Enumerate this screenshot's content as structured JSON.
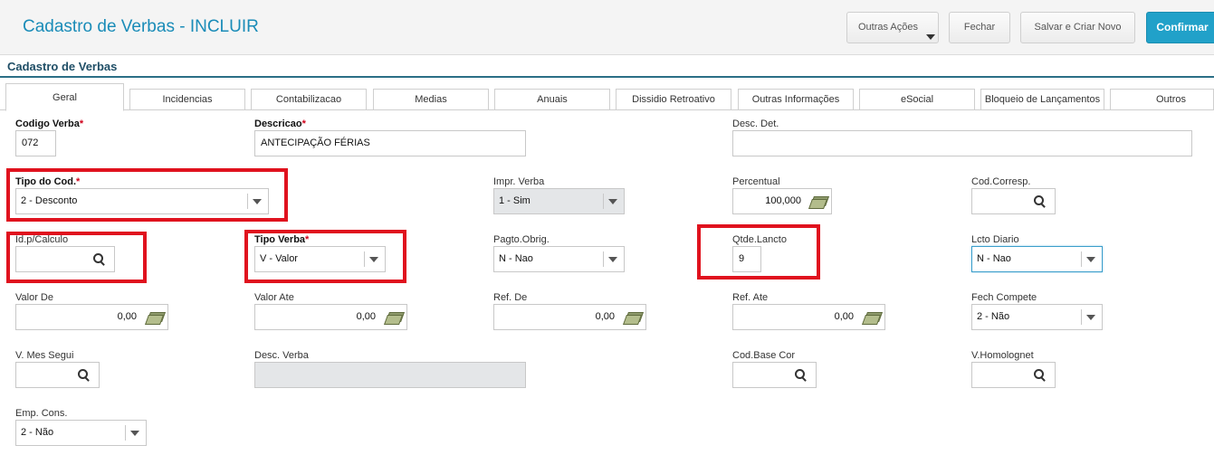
{
  "header": {
    "title": "Cadastro de Verbas - INCLUIR",
    "buttons": {
      "outras_acoes": "Outras Ações",
      "fechar": "Fechar",
      "salvar_criar": "Salvar e Criar Novo",
      "confirmar": "Confirmar"
    }
  },
  "section_title": "Cadastro de Verbas",
  "tabs": [
    "Geral",
    "Incidencias",
    "Contabilizacao",
    "Medias",
    "Anuais",
    "Dissidio Retroativo",
    "Outras Informações",
    "eSocial",
    "Bloqueio de Lançamentos",
    "Outros"
  ],
  "required_mark": "*",
  "fields": {
    "codigo_verba": {
      "label": "Codigo Verba",
      "value": "072"
    },
    "descricao": {
      "label": "Descricao",
      "value": "ANTECIPAÇÃO FÉRIAS"
    },
    "desc_det": {
      "label": "Desc. Det.",
      "value": ""
    },
    "tipo_cod": {
      "label": "Tipo do Cod.",
      "value": "2 - Desconto"
    },
    "impr_verba": {
      "label": "Impr. Verba",
      "value": "1 - Sim"
    },
    "percentual": {
      "label": "Percentual",
      "value": "100,000"
    },
    "cod_corresp": {
      "label": "Cod.Corresp.",
      "value": ""
    },
    "id_calculo": {
      "label": "Id.p/Calculo",
      "value": ""
    },
    "tipo_verba": {
      "label": "Tipo Verba",
      "value": "V - Valor"
    },
    "pagto_obrig": {
      "label": "Pagto.Obrig.",
      "value": "N - Nao"
    },
    "qtde_lancto": {
      "label": "Qtde.Lancto",
      "value": "9"
    },
    "lcto_diario": {
      "label": "Lcto Diario",
      "value": "N - Nao"
    },
    "valor_de": {
      "label": "Valor De",
      "value": "0,00"
    },
    "valor_ate": {
      "label": "Valor Ate",
      "value": "0,00"
    },
    "ref_de": {
      "label": "Ref. De",
      "value": "0,00"
    },
    "ref_ate": {
      "label": "Ref. Ate",
      "value": "0,00"
    },
    "fech_compete": {
      "label": "Fech Compete",
      "value": "2 - Não"
    },
    "v_mes_segui": {
      "label": "V. Mes Segui",
      "value": ""
    },
    "desc_verba": {
      "label": "Desc. Verba",
      "value": ""
    },
    "cod_base_cor": {
      "label": "Cod.Base Cor",
      "value": ""
    },
    "v_homolognet": {
      "label": "V.Homolognet",
      "value": ""
    },
    "emp_cons": {
      "label": "Emp. Cons.",
      "value": "2 - Não"
    }
  },
  "colors": {
    "accent": "#1a8cb8",
    "primary_button": "#21a1c9",
    "highlight": "#e0121e",
    "required": "#d0021b"
  }
}
